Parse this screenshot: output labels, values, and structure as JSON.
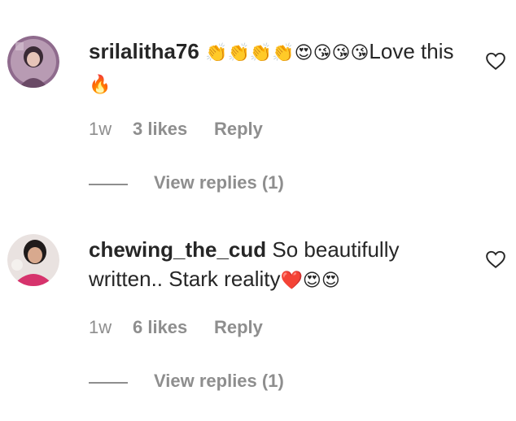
{
  "comments": [
    {
      "username": "srilalitha76",
      "text_parts": [
        "👏👏👏👏😍😘😘😘",
        "Love this ",
        "🔥"
      ],
      "time": "1w",
      "likes": "3 likes",
      "reply_label": "Reply",
      "view_replies": "View replies (1)"
    },
    {
      "username": "chewing_the_cud",
      "text_parts": [
        " So beautifully written.. Stark reality",
        "❤️😍😍"
      ],
      "time": "1w",
      "likes": "6 likes",
      "reply_label": "Reply",
      "view_replies": "View replies (1)"
    }
  ],
  "colors": {
    "text": "#262626",
    "secondary": "#8e8e8e",
    "avatar1": "#8a6a86",
    "avatar2": "#d6336c"
  },
  "icons": {
    "like": "heart-outline-icon"
  }
}
